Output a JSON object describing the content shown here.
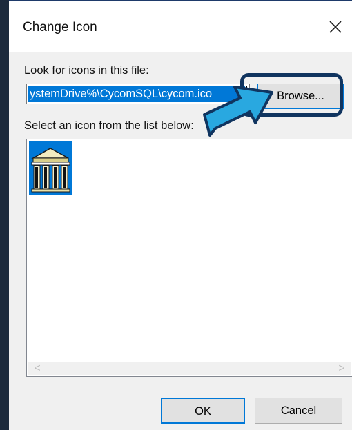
{
  "dialog": {
    "title": "Change Icon",
    "close_icon": "close-icon",
    "file_label": "Look for icons in this file:",
    "file_value": "%SystemDrive%\\CycomSQL\\cycom.ico",
    "file_visible": "ystemDrive%\\CycomSQL\\cycom.ico",
    "browse_label": "Browse...",
    "list_label": "Select an icon from the list below:",
    "icons": [
      {
        "name": "cycom-building-icon",
        "selected": true
      }
    ],
    "scroll_left": "<",
    "scroll_right": ">",
    "ok_label": "OK",
    "cancel_label": "Cancel"
  },
  "colors": {
    "accent": "#0078d7",
    "highlight_outline": "#10345f",
    "arrow_fill": "#29a8e0"
  }
}
